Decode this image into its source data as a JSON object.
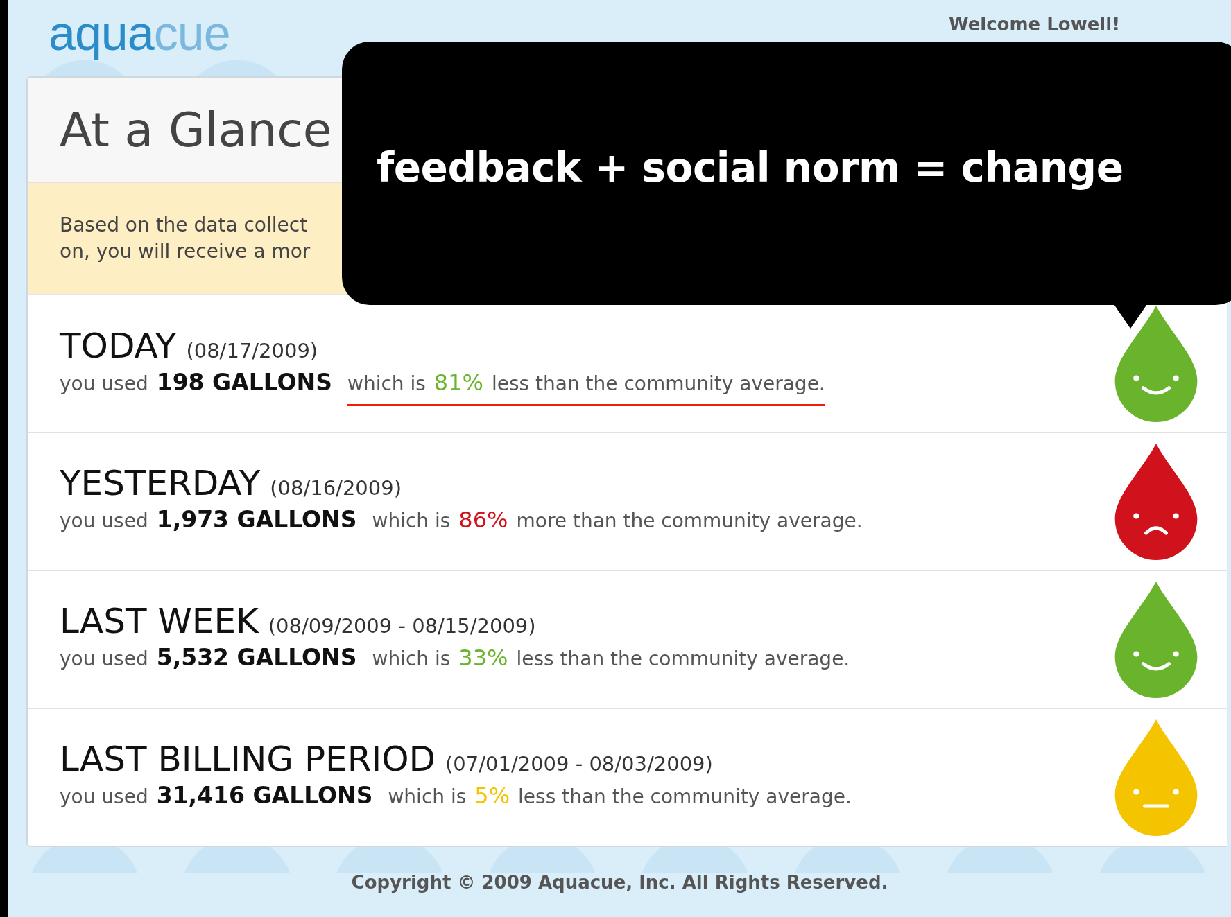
{
  "logo": {
    "first": "aqua",
    "second": "cue"
  },
  "welcome": "Welcome Lowell!",
  "panel": {
    "title": "At a Glance",
    "notice_lines": [
      "Based on the data collect",
      "on, you will receive a mor"
    ]
  },
  "rows": [
    {
      "period": "TODAY",
      "dates": "(08/17/2009)",
      "prefix": "you used",
      "amount": "198 GALLONS",
      "which": "which is",
      "percent": "81%",
      "suffix": "less than the community average.",
      "kind": "happy",
      "color": "#6ab42d",
      "underlined": true
    },
    {
      "period": "YESTERDAY",
      "dates": "(08/16/2009)",
      "prefix": "you used",
      "amount": "1,973 GALLONS",
      "which": "which is",
      "percent": "86%",
      "suffix": "more than the community average.",
      "kind": "sad",
      "color": "#d0121d",
      "underlined": false
    },
    {
      "period": "LAST WEEK",
      "dates": "(08/09/2009 - 08/15/2009)",
      "prefix": "you used",
      "amount": "5,532 GALLONS",
      "which": "which is",
      "percent": "33%",
      "suffix": "less than the community average.",
      "kind": "happy",
      "color": "#6ab42d",
      "underlined": false
    },
    {
      "period": "LAST BILLING PERIOD",
      "dates": "(07/01/2009 - 08/03/2009)",
      "prefix": "you used",
      "amount": "31,416 GALLONS",
      "which": "which is",
      "percent": "5%",
      "suffix": "less than the community average.",
      "kind": "neutral",
      "color": "#f5c400",
      "underlined": false
    }
  ],
  "footer": "Copyright © 2009 Aquacue, Inc. All Rights Reserved.",
  "callout": "feedback + social norm = change"
}
